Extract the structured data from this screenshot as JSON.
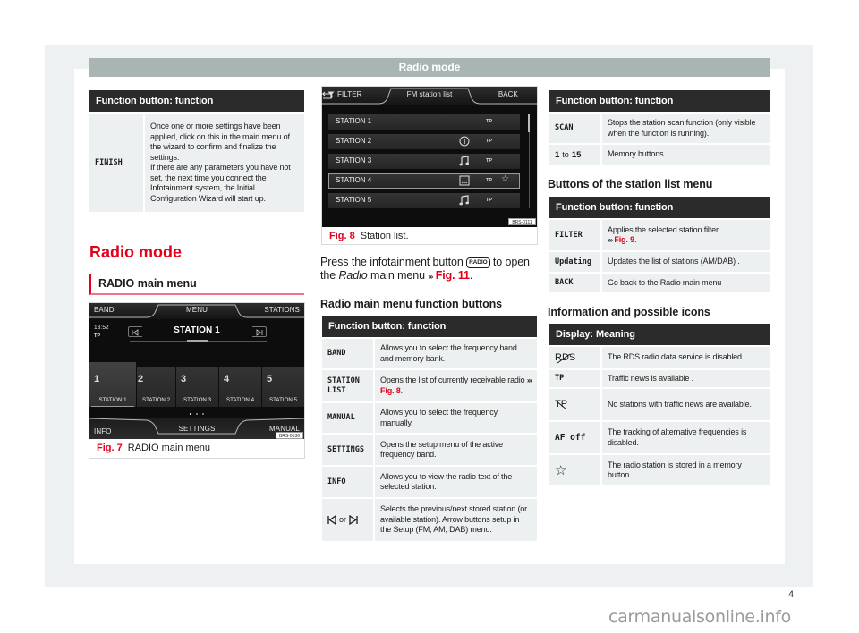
{
  "page": {
    "header_title": "Radio mode",
    "page_number": "4",
    "watermark": "carmanualsonline.info",
    "ref_marker": "›››"
  },
  "colors": {
    "accent_red": "#e3001b",
    "header_bar": "#a9b5b3",
    "table_header": "#2b2b2b",
    "cell_bg": "#edf0f0",
    "page_bg": "#eef1f2"
  },
  "finish_table": {
    "header": "Function button: function",
    "rows": [
      {
        "key": "FINISH",
        "desc": "Once one or more settings have been applied, click on this in the main menu of the wizard to confirm and finalize the settings.\nIf there are any parameters you have not set, the next time you connect the Infotainment system, the Initial Configuration Wizard will start up."
      }
    ]
  },
  "section": {
    "title": "Radio mode",
    "subtitle": "RADIO main menu"
  },
  "fig7": {
    "label": "Fig. 7",
    "caption": "RADIO main menu",
    "code": "BRS-0136",
    "screen": {
      "top_bar": {
        "left": "BAND",
        "center": "MENU",
        "right": "STATIONS"
      },
      "time": "13:52",
      "tp": "TP",
      "current_station": "STATION 1",
      "presets": [
        {
          "number": "1",
          "name": "STATION 1",
          "selected": true
        },
        {
          "number": "2",
          "name": "STATION 2",
          "selected": false
        },
        {
          "number": "3",
          "name": "STATION 3",
          "selected": false
        },
        {
          "number": "4",
          "name": "STATION 4",
          "selected": false
        },
        {
          "number": "5",
          "name": "STATION 5",
          "selected": false
        }
      ],
      "page_dots": 3,
      "active_dot": 1,
      "bottom_bar": {
        "left": "INFO",
        "center": "SETTINGS",
        "right": "MANUAL"
      }
    }
  },
  "fig8": {
    "label": "Fig. 8",
    "caption": "Station list.",
    "code": "BRS-0111",
    "screen": {
      "top_bar": {
        "left": "FILTER",
        "center": "FM station list",
        "right": "BACK"
      },
      "stations": [
        {
          "name": "STATION 1",
          "icon": "",
          "tp": "TP",
          "favorite": false,
          "selected": false
        },
        {
          "name": "STATION 2",
          "icon": "info-icon",
          "tp": "TP",
          "favorite": false,
          "selected": false
        },
        {
          "name": "STATION 3",
          "icon": "music-note-icon",
          "tp": "TP",
          "favorite": false,
          "selected": false
        },
        {
          "name": "STATION 4",
          "icon": "radio-text-icon",
          "tp": "TP",
          "favorite": true,
          "selected": true
        },
        {
          "name": "STATION 5",
          "icon": "music-note-icon",
          "tp": "TP",
          "favorite": false,
          "selected": false
        }
      ],
      "favorite_glyph": "☆"
    }
  },
  "intro": {
    "text_1": "Press the infotainment button",
    "button": "RADIO",
    "text_2": "to open the",
    "italic": "Radio",
    "text_3": "main menu",
    "link": "Fig. 11",
    "end": "."
  },
  "main_menu_table": {
    "title": "Radio main menu function buttons",
    "header": "Function button: function",
    "rows": [
      {
        "key": "BAND",
        "desc": "Allows you to select the frequency band and memory bank."
      },
      {
        "key": "STATION\nLIST",
        "desc": "Opens the list of currently receivable radio",
        "link": "Fig. 8",
        "end": "."
      },
      {
        "key": "MANUAL",
        "desc": "Allows you to select the frequency manually."
      },
      {
        "key": "SETTINGS",
        "desc": "Opens the setup menu of the active frequency band."
      },
      {
        "key": "INFO",
        "desc": "Allows you to view the radio text of the selected station."
      },
      {
        "key_icons": [
          "previous-station-icon",
          "next-station-icon"
        ],
        "key_join": "or",
        "desc": "Selects the previous/next stored station (or available station). Arrow buttons setup in the Setup (FM, AM, DAB) menu."
      }
    ]
  },
  "continued_table": {
    "header": "Function button: function",
    "rows": [
      {
        "key": "SCAN",
        "desc": "Stops the station scan function (only visible when the function is running)."
      },
      {
        "key_from": "1",
        "key_join": "to",
        "key_to": "15",
        "desc": "Memory buttons."
      }
    ]
  },
  "station_list_table": {
    "title": "Buttons of the station list menu",
    "header": "Function button: function",
    "rows": [
      {
        "key": "FILTER",
        "desc": "Applies the selected station filter",
        "link": "Fig. 9",
        "end": "."
      },
      {
        "key": "Updating",
        "desc": "Updates the list of stations (AM/DAB) ."
      },
      {
        "key": "BACK",
        "desc": "Go back to the Radio main menu"
      }
    ]
  },
  "icons_table": {
    "title": "Information and possible icons",
    "header": "Display: Meaning",
    "rows": [
      {
        "icon": "rds-disabled-icon",
        "icon_text": "RDS",
        "desc": "The RDS radio data service is disabled."
      },
      {
        "key": "TP",
        "desc": "Traffic news is available ."
      },
      {
        "icon": "tp-unavailable-icon",
        "icon_text": "TP",
        "desc": "No stations with traffic news are available."
      },
      {
        "key": "AF off",
        "desc": "The tracking of alternative frequencies is disabled."
      },
      {
        "icon": "star-icon",
        "icon_text": "☆",
        "desc": "The radio station is stored in a memory button."
      }
    ]
  }
}
